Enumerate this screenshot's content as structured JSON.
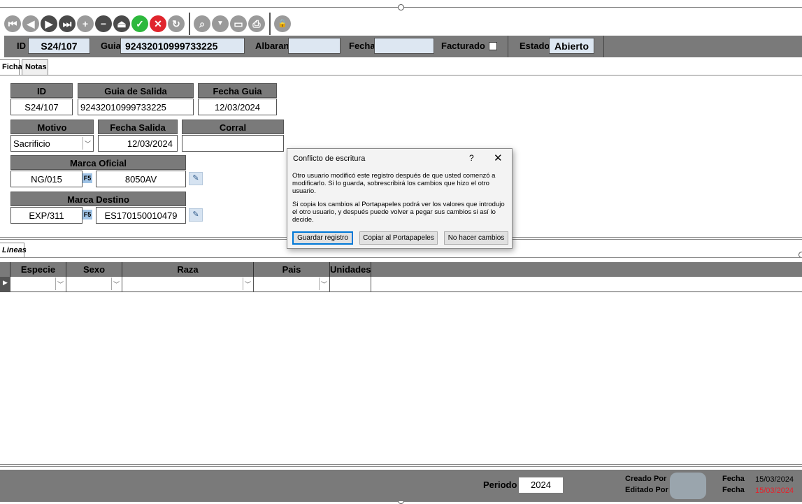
{
  "toolbar": {
    "buttons": [
      {
        "icon": "first-record-icon",
        "glyph": "⏮"
      },
      {
        "icon": "previous-record-icon",
        "glyph": "◀"
      },
      {
        "icon": "next-record-icon",
        "glyph": "▶"
      },
      {
        "icon": "last-record-icon",
        "glyph": "⏭"
      },
      {
        "icon": "add-record-icon",
        "glyph": "+"
      },
      {
        "icon": "delete-record-icon",
        "glyph": "−"
      },
      {
        "icon": "edit-record-icon",
        "glyph": "⏏"
      },
      {
        "icon": "save-record-icon",
        "glyph": "✓"
      },
      {
        "icon": "cancel-record-icon",
        "glyph": "✕"
      },
      {
        "icon": "refresh-icon",
        "glyph": "↻"
      },
      {
        "icon": "search-icon",
        "glyph": "⌕"
      },
      {
        "icon": "filter-icon",
        "glyph": "▼"
      },
      {
        "icon": "preview-icon",
        "glyph": "▭"
      },
      {
        "icon": "print-icon",
        "glyph": "⎙"
      },
      {
        "icon": "lock-icon",
        "glyph": "🔒"
      }
    ]
  },
  "header": {
    "id_label": "ID",
    "id_value": "S24/107",
    "guia_label": "Guia",
    "guia_value": "92432010999733225",
    "albaran_label": "Albaran",
    "albaran_value": "",
    "fecha_label": "Fecha",
    "fecha_value": "",
    "facturado_label": "Facturado",
    "estado_label": "Estado",
    "estado_value": "Abierto"
  },
  "tabs": {
    "ficha": "Ficha",
    "notas": "Notas"
  },
  "form": {
    "id_label": "ID",
    "id_value": "S24/107",
    "guia_salida_label": "Guia de Salida",
    "guia_salida_value": "92432010999733225",
    "fecha_guia_label": "Fecha Guia",
    "fecha_guia_value": "12/03/2024",
    "motivo_label": "Motivo",
    "motivo_value": "Sacrificio",
    "fecha_salida_label": "Fecha Salida",
    "fecha_salida_value": "12/03/2024",
    "corral_label": "Corral",
    "corral_value": "",
    "marca_oficial_label": "Marca Oficial",
    "marca_oficial_code": "NG/015",
    "marca_oficial_f5": "F5",
    "marca_oficial_value": "8050AV",
    "marca_destino_label": "Marca Destino",
    "marca_destino_code": "EXP/311",
    "marca_destino_f5": "F5",
    "marca_destino_value": "ES170150010479"
  },
  "lines": {
    "tab_label": "Lineas",
    "columns": [
      "Especie",
      "Sexo",
      "Raza",
      "Pais",
      "Unidades"
    ]
  },
  "footer": {
    "periodo_label": "Periodo",
    "periodo_value": "2024",
    "creado_por_label": "Creado Por",
    "editado_por_label": "Editado Por",
    "fecha1_label": "Fecha",
    "fecha1_value": "15/03/2024",
    "fecha2_label": "Fecha",
    "fecha2_value": "15/03/2024",
    "fecha2_color": "#e8202a"
  },
  "dialog": {
    "title": "Conflicto de escritura",
    "help": "?",
    "close": "✕",
    "paragraph1": "Otro usuario modificó este registro después de que usted comenzó a modificarlo. Si lo guarda, sobrescribirá los cambios que hizo el otro usuario.",
    "paragraph2": "Si copia los cambios al Portapapeles podrá ver los valores que introdujo el otro usuario, y después puede volver a pegar sus cambios si así lo decide.",
    "btn_save": "Guardar registro",
    "btn_copy": "Copiar al Portapapeles",
    "btn_none": "No hacer cambios"
  }
}
